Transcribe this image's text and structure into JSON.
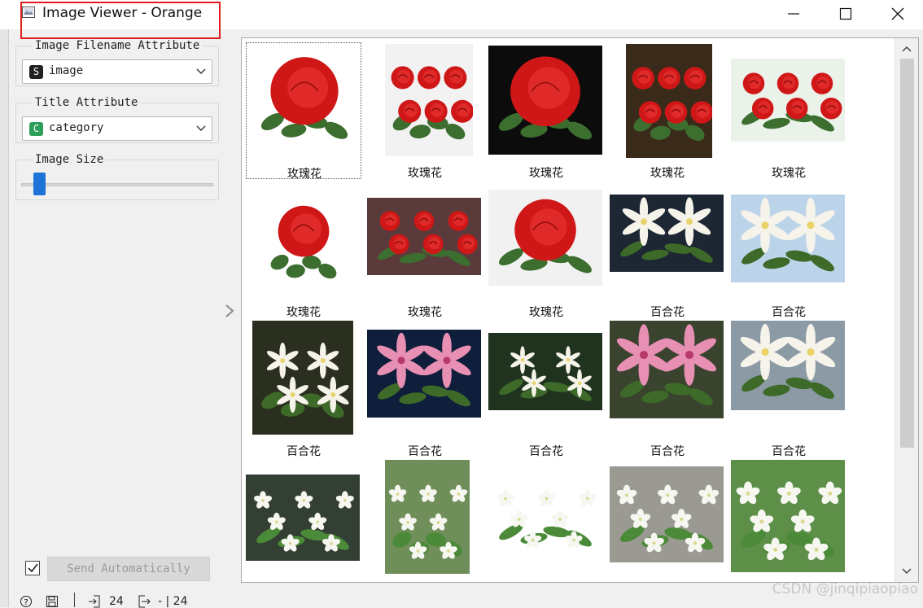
{
  "window": {
    "title": "Image Viewer - Orange",
    "controls": [
      "minimize-icon",
      "maximize-icon",
      "close-icon"
    ]
  },
  "sidebar": {
    "filename_attr": {
      "label": "Image Filename Attribute",
      "badge": "S",
      "badge_color": "#222222",
      "value": "image"
    },
    "title_attr": {
      "label": "Title Attribute",
      "badge": "C",
      "badge_color": "#2e9e5b",
      "value": "category"
    },
    "image_size": {
      "label": "Image Size",
      "level": 0.1
    }
  },
  "footer": {
    "send_automatically": {
      "checked": true,
      "label": "Send Automatically"
    },
    "input_count": "24",
    "output_count": "- | 24"
  },
  "gallery": {
    "selected_index": 0,
    "items": [
      {
        "caption": "玫瑰花",
        "kind": "rose",
        "variant": "single"
      },
      {
        "caption": "玫瑰花",
        "kind": "rose",
        "variant": "bouquet"
      },
      {
        "caption": "玫瑰花",
        "kind": "rose",
        "variant": "single-dark"
      },
      {
        "caption": "玫瑰花",
        "kind": "rose",
        "variant": "bush"
      },
      {
        "caption": "玫瑰花",
        "kind": "rose",
        "variant": "bush-green"
      },
      {
        "caption": "玫瑰花",
        "kind": "rose",
        "variant": "stem"
      },
      {
        "caption": "玫瑰花",
        "kind": "rose",
        "variant": "bunch"
      },
      {
        "caption": "玫瑰花",
        "kind": "rose",
        "variant": "closeup"
      },
      {
        "caption": "百合花",
        "kind": "lily",
        "variant": "white-dark"
      },
      {
        "caption": "百合花",
        "kind": "lily",
        "variant": "white-sky"
      },
      {
        "caption": "百合花",
        "kind": "lily",
        "variant": "bouquet"
      },
      {
        "caption": "百合花",
        "kind": "lily",
        "variant": "pink-blue"
      },
      {
        "caption": "百合花",
        "kind": "lily",
        "variant": "white-garden"
      },
      {
        "caption": "百合花",
        "kind": "lily",
        "variant": "pink"
      },
      {
        "caption": "百合花",
        "kind": "lily",
        "variant": "white-close"
      },
      {
        "caption": "",
        "kind": "jasmine",
        "variant": "white-lilies"
      },
      {
        "caption": "",
        "kind": "jasmine",
        "variant": "cluster"
      },
      {
        "caption": "",
        "kind": "jasmine",
        "variant": "buds"
      },
      {
        "caption": "",
        "kind": "jasmine",
        "variant": "bonsai"
      },
      {
        "caption": "",
        "kind": "jasmine",
        "variant": "blossoms"
      }
    ]
  },
  "watermark": "CSDN @jinqipiaopiao",
  "colors": {
    "highlight_box": "#e21b1b",
    "slider_handle": "#1e73d6"
  }
}
